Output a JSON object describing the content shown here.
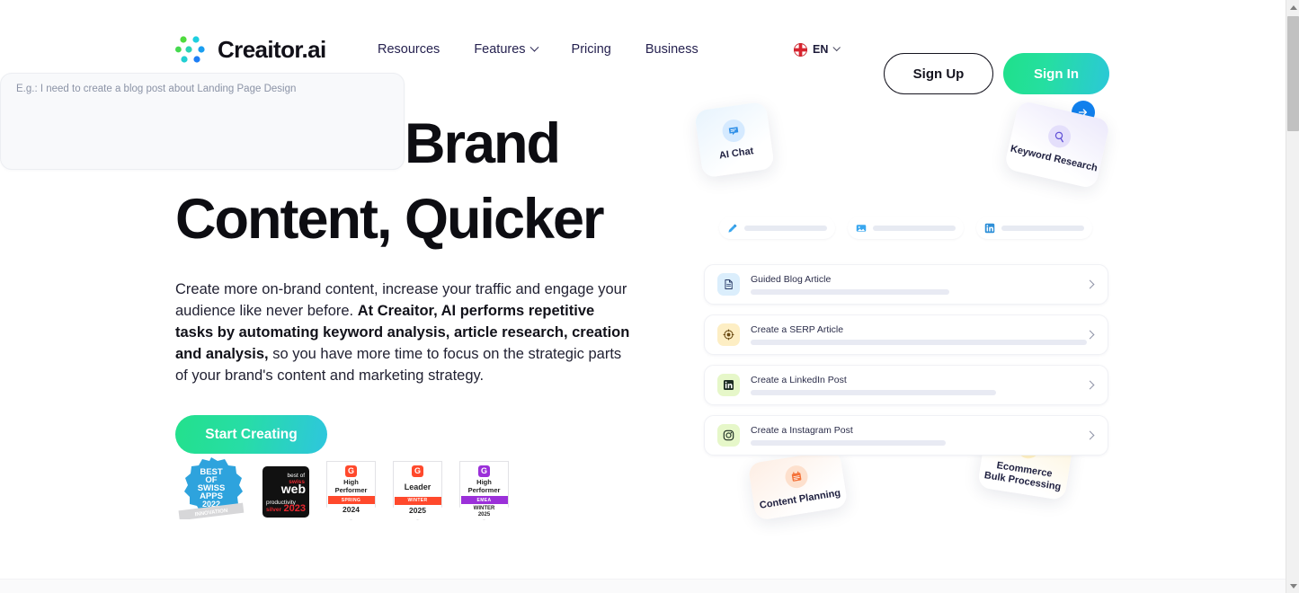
{
  "brand": {
    "name": "Creaitor.ai",
    "logo_icon": "creaitor-nodes-logo",
    "gradient_start": "#23e08c",
    "gradient_end": "#2ec6de"
  },
  "header": {
    "nav": [
      {
        "label": "Resources",
        "has_dropdown": false
      },
      {
        "label": "Features",
        "has_dropdown": true
      },
      {
        "label": "Pricing",
        "has_dropdown": false
      },
      {
        "label": "Business",
        "has_dropdown": false
      }
    ],
    "language": {
      "code": "EN",
      "flag": "uk-flag-icon"
    },
    "sign_up": "Sign Up",
    "sign_in": "Sign In"
  },
  "hero": {
    "headline": "Craft On-Brand\nContent, Quicker",
    "paragraph_part1": "Create more on-brand content, increase your traffic and engage your audience like never before. ",
    "paragraph_bold": "At Creaitor, AI performs repetitive tasks by automating keyword analysis, article research, creation and analysis,",
    "paragraph_part2": " so you have more time to focus on the strategic parts of your brand's content and marketing strategy.",
    "cta_label": "Start Creating"
  },
  "badges": [
    {
      "name": "best-of-swiss-apps-2022",
      "lines": [
        "BEST",
        "OF",
        "SWISS",
        "APPS",
        "2022"
      ],
      "ribbon": "INNOVATION",
      "color": "#2ea3dd"
    },
    {
      "name": "best-of-swiss-web-2023",
      "line1": "best of",
      "line2": "swiss",
      "line3": "web",
      "line4": "productivity",
      "line5": "silver",
      "year": "2023"
    },
    {
      "name": "g2-high-performer-spring-2024",
      "logo": "G",
      "title": "High\nPerformer",
      "band": "SPRING",
      "year": "2024",
      "accent": "#ff492c"
    },
    {
      "name": "g2-leader-winter-2025",
      "logo": "G",
      "title": "Leader",
      "band": "WINTER",
      "year": "2025",
      "accent": "#ff492c"
    },
    {
      "name": "g2-high-performer-emea-winter-2025",
      "logo": "G",
      "title": "High\nPerformer",
      "band": "EMEA",
      "year": "WINTER\n2025",
      "accent": "#9b30d9"
    }
  ],
  "product_preview": {
    "prompt_placeholder": "E.g.: I need to create a blog post about Landing Page Design",
    "send_icon": "arrow-right-icon",
    "chips": [
      {
        "icon": "pencil-icon"
      },
      {
        "icon": "image-icon"
      },
      {
        "icon": "linkedin-icon"
      }
    ],
    "rows": [
      {
        "title": "Guided Blog Article",
        "icon": "document-icon",
        "tile": "#dbeefc",
        "bar_width": "59%"
      },
      {
        "title": "Create a SERP Article",
        "icon": "target-icon",
        "tile": "#fdeec4",
        "bar_width": "100%"
      },
      {
        "title": "Create a LinkedIn Post",
        "icon": "linkedin-icon",
        "tile": "#e6f7c9",
        "bar_width": "73%"
      },
      {
        "title": "Create a Instagram Post",
        "icon": "instagram-icon",
        "tile": "#e6f7c9",
        "bar_width": "58%"
      }
    ],
    "floating_cards": [
      {
        "label": "AI Chat",
        "icon": "chat-bubble-icon",
        "accent": "#1f8ff0"
      },
      {
        "label": "Keyword Research",
        "icon": "search-icon",
        "accent": "#6b5ce7"
      },
      {
        "label": "Content Planning",
        "icon": "calendar-icon",
        "accent": "#f4733a"
      },
      {
        "label": "Ecommerce\nBulk Processing",
        "icon": "cart-icon",
        "accent": "#f0b623"
      }
    ]
  }
}
